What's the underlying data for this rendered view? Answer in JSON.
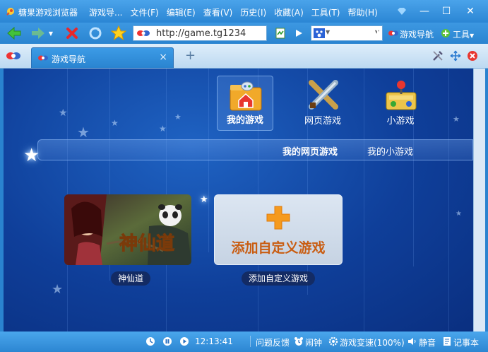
{
  "window": {
    "app_title": "糖果游戏浏览器",
    "menu": [
      "游戏导...",
      "文件(F)",
      "编辑(E)",
      "查看(V)",
      "历史(I)",
      "收藏(A)",
      "工具(T)",
      "帮助(H)"
    ]
  },
  "toolbar": {
    "url": "http://game.tg1234",
    "nav_link": "游戏导航",
    "tools_label": "工具"
  },
  "tabs": [
    {
      "label": "游戏导航"
    }
  ],
  "categories": [
    {
      "label": "我的游戏",
      "icon": "house-folder-icon",
      "active": true
    },
    {
      "label": "网页游戏",
      "icon": "crossed-swords-icon",
      "active": false
    },
    {
      "label": "小游戏",
      "icon": "joystick-icon",
      "active": false
    }
  ],
  "subtabs": [
    {
      "label": "我的网页游戏",
      "active": true
    },
    {
      "label": "我的小游戏",
      "active": false
    }
  ],
  "games": [
    {
      "name": "神仙道",
      "thumb_title": "神仙道"
    }
  ],
  "add_tile": {
    "text": "添加自定义游戏",
    "label": "添加自定义游戏"
  },
  "statusbar": {
    "time": "12:13:41",
    "feedback": "问题反馈",
    "alarm": "闹钟",
    "speed": "游戏变速(100%)",
    "mute": "静音",
    "notepad": "记事本"
  },
  "colors": {
    "accent": "#2a84d0",
    "content_bg": "#0f3f9a",
    "add_text": "#c95d12"
  }
}
